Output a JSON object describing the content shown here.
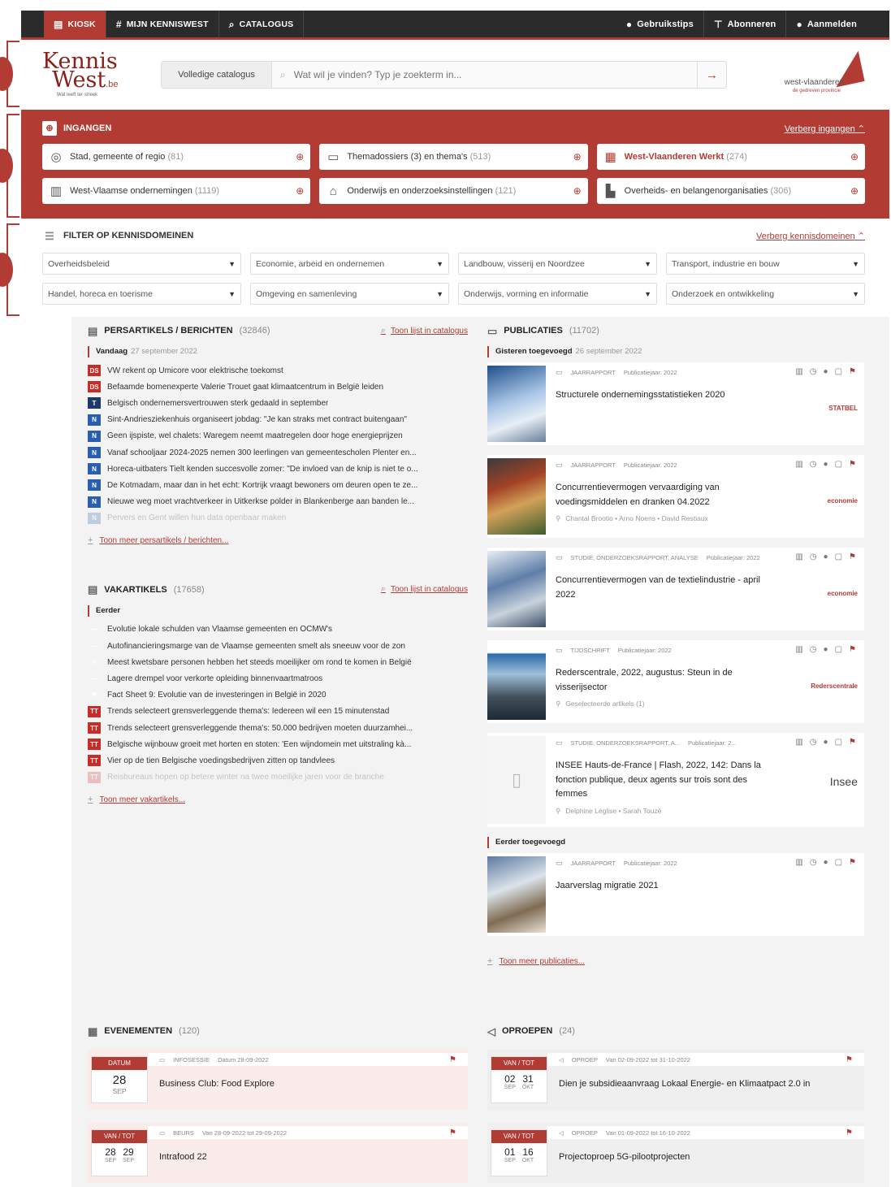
{
  "topbar": {
    "left": [
      {
        "label": "KIOSK",
        "icon": "kiosk-icon"
      },
      {
        "label": "MIJN KENNISWEST",
        "icon": "hash-icon"
      },
      {
        "label": "CATALOGUS",
        "icon": "search-icon"
      }
    ],
    "right": [
      {
        "label": "Gebruikstips",
        "icon": "bulb-icon"
      },
      {
        "label": "Abonneren",
        "icon": "subscribe-icon"
      },
      {
        "label": "Aanmelden",
        "icon": "user-icon"
      }
    ]
  },
  "header": {
    "logo_line1": "Kennis",
    "logo_line2": "West",
    "logo_suffix": ".be",
    "logo_tagline": "Wat leeft ter streek",
    "search_scope": "Volledige catalogus",
    "search_placeholder": "Wat wil je vinden? Typ je zoekterm in...",
    "province_name": "west-vlaanderen",
    "province_sub": "de gedreven provincie"
  },
  "ingangen": {
    "title": "INGANGEN",
    "hide_link": "Verberg ingangen",
    "cards": [
      {
        "label": "Stad, gemeente of regio",
        "count": "(81)",
        "icon": "map-icon"
      },
      {
        "label": "Themadossiers (3) en thema's",
        "count": "(513)",
        "icon": "folder-icon"
      },
      {
        "label": "West-Vlaanderen Werkt",
        "count": "(274)",
        "icon": "magazine-icon",
        "highlight": true
      },
      {
        "label": "West-Vlaamse ondernemingen",
        "count": "(1119)",
        "icon": "building-icon"
      },
      {
        "label": "Onderwijs en onderzoeksinstellingen",
        "count": "(121)",
        "icon": "graduation-icon"
      },
      {
        "label": "Overheids- en belangenorganisaties",
        "count": "(306)",
        "icon": "organisation-icon"
      }
    ]
  },
  "filter": {
    "title": "FILTER OP KENNISDOMEINEN",
    "hide_link": "Verberg kennisdomeinen",
    "selects": [
      "Overheidsbeleid",
      "Economie, arbeid en ondernemen",
      "Landbouw, visserij en Noordzee",
      "Transport, industrie en bouw",
      "Handel, horeca en toerisme",
      "Omgeving en samenleving",
      "Onderwijs, vorming en informatie",
      "Onderzoek en ontwikkeling"
    ]
  },
  "persartikels": {
    "title": "PERSARTIKELS / BERICHTEN",
    "count": "(32846)",
    "list_link": "Toon lijst in catalogus",
    "day": "Vandaag",
    "date": "27 september 2022",
    "items": [
      {
        "src": "DS",
        "cls": "ds",
        "text": "VW rekent op Umicore voor elektrische toekomst"
      },
      {
        "src": "DS",
        "cls": "ds",
        "text": "Befaamde bomenexperte Valerie Trouet gaat klimaatcentrum in België leiden"
      },
      {
        "src": "T",
        "cls": "t",
        "text": "Belgisch ondernemersvertrouwen sterk gedaald in september"
      },
      {
        "src": "N",
        "cls": "n",
        "text": "Sint-Andriesziekenhuis organiseert jobdag: \"Je kan straks met contract buitengaan\""
      },
      {
        "src": "N",
        "cls": "n",
        "text": "Geen ijspiste, wel chalets: Waregem neemt maatregelen door hoge energieprijzen"
      },
      {
        "src": "N",
        "cls": "n",
        "text": "Vanaf schooljaar 2024-2025 nemen 300 leerlingen van gemeentescholen Plenter en..."
      },
      {
        "src": "N",
        "cls": "n",
        "text": "Horeca-uitbaters Tielt kenden succesvolle zomer: \"De invloed van de knip is niet te o..."
      },
      {
        "src": "N",
        "cls": "n",
        "text": "De Kotmadam, maar dan in het echt: Kortrijk vraagt bewoners om deuren open te ze..."
      },
      {
        "src": "N",
        "cls": "n",
        "text": "Nieuwe weg moet vrachtverkeer in Uitkerkse polder in Blankenberge aan banden le..."
      },
      {
        "src": "N",
        "cls": "n",
        "text": "Pervers en Gent willen hun data openbaar maken",
        "fade": true
      }
    ],
    "more": "Toon meer persartikels / berichten..."
  },
  "vakartikels": {
    "title": "VAKARTIKELS",
    "count": "(17658)",
    "list_link": "Toon lijst in catalogus",
    "day": "Eerder",
    "items": [
      {
        "src": "—",
        "cls": "line",
        "text": "Evolutie lokale schulden van Vlaamse gemeenten en OCMW's"
      },
      {
        "src": "—",
        "cls": "line",
        "text": "Autofinancieringsmarge van de Vlaamse gemeenten smelt als sneeuw voor de zon"
      },
      {
        "src": "⚐",
        "cls": "line",
        "text": "Meest kwetsbare personen hebben het steeds moeilijker om rond te komen in België"
      },
      {
        "src": "—",
        "cls": "line",
        "text": "Lagere drempel voor verkorte opleiding binnenvaartmatroos"
      },
      {
        "src": "⚑",
        "cls": "line",
        "text": "Fact Sheet 9: Evolutie van de investeringen in België in 2020"
      },
      {
        "src": "TT",
        "cls": "tt",
        "text": "Trends selecteert grensverleggende thema's: Iedereen wil een 15 minutenstad"
      },
      {
        "src": "TT",
        "cls": "tt",
        "text": "Trends selecteert grensverleggende thema's: 50.000 bedrijven moeten duurzamhei..."
      },
      {
        "src": "TT",
        "cls": "tt",
        "text": "Belgische wijnbouw groeit met horten en stoten: 'Een wijndomein met uitstraling kà..."
      },
      {
        "src": "TT",
        "cls": "tt",
        "text": "Vier op de tien Belgische voedingsbedrijven zitten op tandvlees"
      },
      {
        "src": "TT",
        "cls": "tt",
        "text": "Reisbureaus hopen op betere winter na twee moeilijke jaren voor de branche",
        "fade": true
      }
    ],
    "more": "Toon meer vakartikels..."
  },
  "publicaties": {
    "title": "PUBLICATIES",
    "count": "(11702)",
    "day1": "Gisteren toegevoegd",
    "date1": "26 september 2022",
    "day2": "Eerder toegevoegd",
    "items": [
      {
        "type": "JAARRAPPORT",
        "year": "Publicatiejaar: 2022",
        "title": "Structurele ondernemingsstatistieken 2020",
        "authors": "",
        "publisher": "STATBEL",
        "cover": ""
      },
      {
        "type": "JAARRAPPORT",
        "year": "Publicatiejaar: 2022",
        "title": "Concurrentievermogen vervaardiging van voedingsmiddelen en dranken 04.2022",
        "authors": "Chantal Brootio • Arno Noens • David Restiaux",
        "publisher": "economie",
        "cover": "food"
      },
      {
        "type": "STUDIE, ONDERZOEKSRAPPORT, ANALYSE",
        "year": "Publicatiejaar: 2022",
        "title": "Concurrentievermogen van de textielindustrie - april 2022",
        "authors": "",
        "publisher": "economie",
        "cover": "text"
      },
      {
        "type": "TIJDSCHRIFT",
        "year": "Publicatiejaar: 2022",
        "title": "Rederscentrale, 2022, augustus: Steun in de visserijsector",
        "authors": "Geselecteerde artikels (1)",
        "publisher": "Rederscentrale",
        "cover": "bridge"
      },
      {
        "type": "STUDIE, ONDERZOEKSRAPPORT, A...",
        "year": "Publicatiejaar: 2...",
        "title": "INSEE Hauts-de-France | Flash, 2022, 142: Dans la fonction publique, deux agents sur trois sont des femmes",
        "authors": "Delphine Léglise • Sarah Touzé",
        "publisher": "Insee",
        "cover": "blank"
      }
    ],
    "earlier": [
      {
        "type": "JAARRAPPORT",
        "year": "Publicatiejaar: 2022",
        "title": "Jaarverslag migratie 2021",
        "authors": "",
        "publisher": "",
        "cover": "migr"
      }
    ],
    "more": "Toon meer publicaties..."
  },
  "evenementen": {
    "title": "EVENEMENTEN",
    "count": "(120)",
    "items": [
      {
        "head": "DATUM",
        "type": "INFOSESSIE",
        "meta": "Datum 28-09-2022",
        "title": "Business Club: Food Explore",
        "d1": "28",
        "m1": "SEP",
        "d2": "",
        "m2": "",
        "single": true
      },
      {
        "head": "VAN / TOT",
        "type": "BEURS",
        "meta": "Van 28-09-2022 tot 29-09-2022",
        "title": "Intrafood 22",
        "d1": "28",
        "m1": "SEP",
        "d2": "29",
        "m2": "SEP",
        "single": false
      }
    ]
  },
  "oproepen": {
    "title": "OPROEPEN",
    "count": "(24)",
    "items": [
      {
        "head": "VAN / TOT",
        "type": "OPROEP",
        "meta": "Van 02-09-2022 tot 31-10-2022",
        "title": "Dien je subsidieaanvraag Lokaal Energie- en Klimaatpact 2.0 in",
        "d1": "02",
        "m1": "SEP",
        "d2": "31",
        "m2": "OKT"
      },
      {
        "head": "VAN / TOT",
        "type": "OPROEP",
        "meta": "Van 01-09-2022 tot 16-10-2022",
        "title": "Projectoproep 5G-pilootprojecten",
        "d1": "01",
        "m1": "SEP",
        "d2": "16",
        "m2": "OKT"
      }
    ]
  },
  "colors": {
    "brand": "#b23b34",
    "dark": "#2b2b2b",
    "content_bg": "#f3f3f3"
  }
}
